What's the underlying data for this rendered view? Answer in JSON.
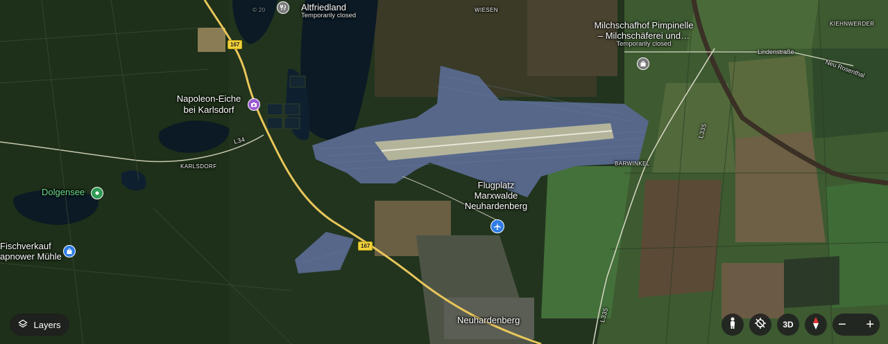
{
  "map": {
    "roads": [
      "167",
      "167",
      "L34",
      "L335",
      "L335"
    ],
    "places": {
      "altfriedland": {
        "name": "Altfriedland",
        "status": "Temporarily closed"
      },
      "wiesen": "WIESEN",
      "milchschafhof": {
        "line1": "Milchschafhof Pimpinelle",
        "line2": "– Milchschäferei und…",
        "status": "Temporarily closed"
      },
      "kiehnwerder": "KIEHNWERDER",
      "lindenstrasse": "Lindenstraße",
      "neu_rosenthal": "Neu Rosenthal",
      "napoleon": {
        "line1": "Napoleon-Eiche",
        "line2": "bei Karlsdorf"
      },
      "karlsdorf": "KARLSDORF",
      "dolgensee": "Dolgensee",
      "barwinkel": "BARWINKEL",
      "flugplatz": {
        "line1": "Flugplatz",
        "line2": "Marxwalde",
        "line3": "Neuhardenberg"
      },
      "fischverkauf": {
        "line1": "Fischverkauf",
        "line2": "apnower Mühle"
      },
      "neuhardenberg": "Neuhardenberg"
    },
    "icons": [
      "restaurant-icon",
      "shopping-bag-icon",
      "camera-icon",
      "park-icon",
      "airport-icon"
    ],
    "watermark": "© 20"
  },
  "controls": {
    "layers_label": "Layers",
    "three_d_label": "3D",
    "zoom_out": "−",
    "zoom_in": "+"
  },
  "colors": {
    "road": "#e8c65a",
    "water": "#0b1a24",
    "solar": "#5b6c8c",
    "field_green": "#3f6a34",
    "forest": "#233a1f",
    "airport_pin": "#2f7de6",
    "poi_pin": "#9b59d0",
    "park_pin": "#2f9a52",
    "shop_pin": "#2f7de6",
    "compass_red": "#e53935"
  }
}
